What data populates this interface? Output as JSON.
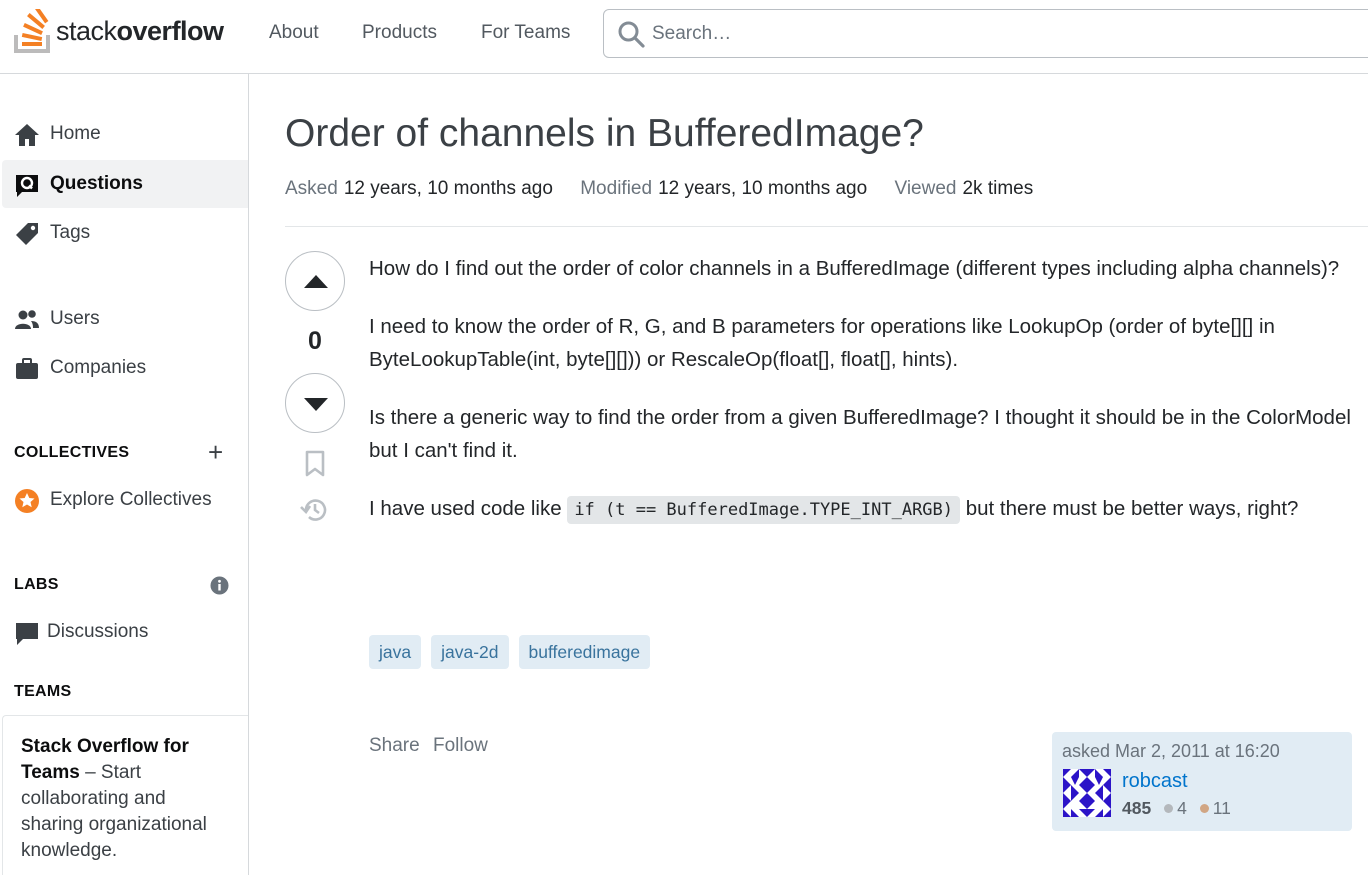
{
  "header": {
    "logo_light": "stack",
    "logo_bold": "overflow",
    "nav": [
      "About",
      "Products",
      "For Teams"
    ],
    "search_placeholder": "Search…"
  },
  "sidebar": {
    "items": [
      {
        "label": "Home"
      },
      {
        "label": "Questions"
      },
      {
        "label": "Tags"
      },
      {
        "label": "Users"
      },
      {
        "label": "Companies"
      }
    ],
    "collectives_heading": "COLLECTIVES",
    "explore_collectives": "Explore Collectives",
    "labs_heading": "LABS",
    "discussions": "Discussions",
    "teams_heading": "TEAMS",
    "teams_title": "Stack Overflow for Teams",
    "teams_text": "– Start collaborating and sharing organizational knowledge."
  },
  "question": {
    "title": "Order of channels in BufferedImage?",
    "asked_label": "Asked",
    "asked_value": "12 years, 10 months ago",
    "modified_label": "Modified",
    "modified_value": "12 years, 10 months ago",
    "viewed_label": "Viewed",
    "viewed_value": "2k times",
    "votes": "0",
    "body": {
      "p1": "How do I find out the order of color channels in a BufferedImage (different types including alpha channels)?",
      "p2": "I need to know the order of R, G, and B parameters for operations like LookupOp (order of byte[][] in ByteLookupTable(int, byte[][])) or RescaleOp(float[], float[], hints).",
      "p3": "Is there a generic way to find the order from a given BufferedImage? I thought it should be in the ColorModel but I can't find it.",
      "p4_before": "I have used code like",
      "p4_code": "if (t == BufferedImage.TYPE_INT_ARGB)",
      "p4_after": "but there must be better ways, right?"
    },
    "tags": [
      "java",
      "java-2d",
      "bufferedimage"
    ],
    "share_label": "Share",
    "follow_label": "Follow",
    "owner": {
      "asked_text": "asked Mar 2, 2011 at 16:20",
      "name": "robcast",
      "reputation": "485",
      "silver": "4",
      "bronze": "11"
    }
  },
  "colors": {
    "accent": "#f48024",
    "link": "#0074cc",
    "tag_bg": "#e1ecf4",
    "tag_text": "#39739d"
  }
}
